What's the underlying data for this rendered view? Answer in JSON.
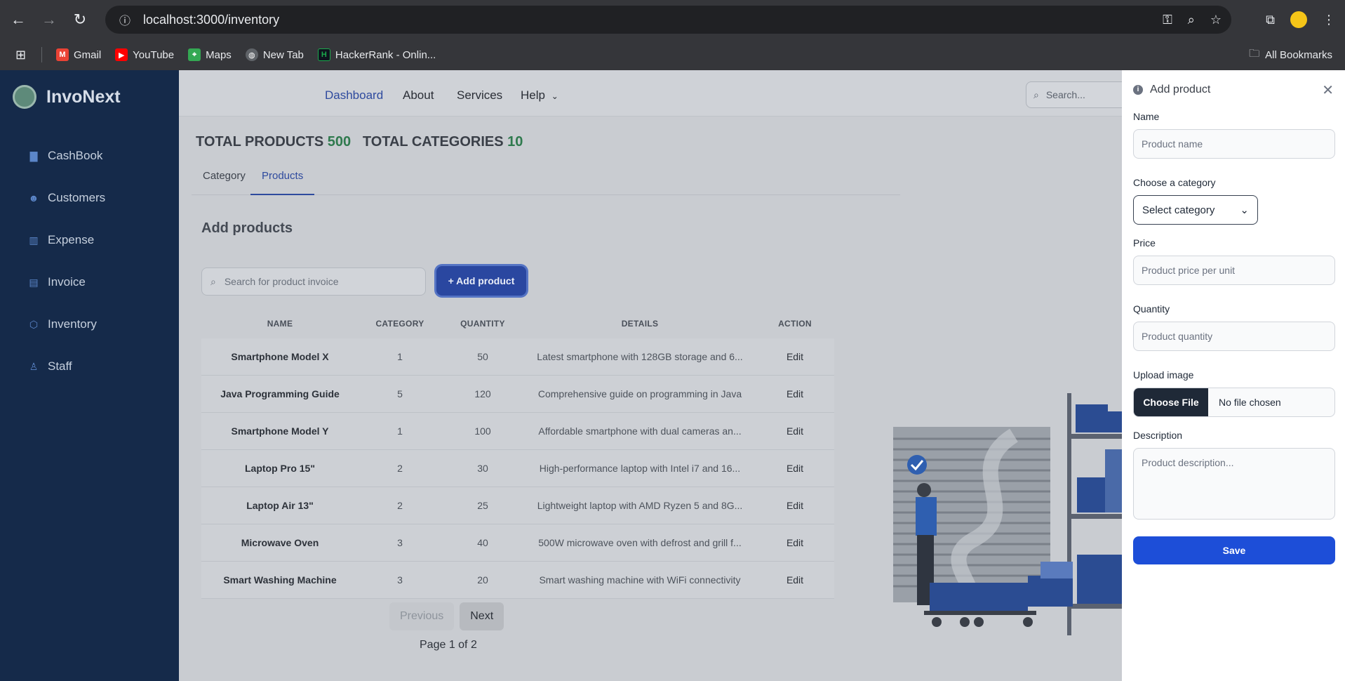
{
  "browser": {
    "url": "localhost:3000/inventory",
    "bookmarks": [
      {
        "label": "Gmail",
        "icon": "gmail-icon",
        "color": "#ea4335"
      },
      {
        "label": "YouTube",
        "icon": "youtube-icon",
        "color": "#ff0000"
      },
      {
        "label": "Maps",
        "icon": "maps-icon",
        "color": "#34a853"
      },
      {
        "label": "New Tab",
        "icon": "globe-icon",
        "color": "#9aa0a6"
      },
      {
        "label": "HackerRank - Onlin...",
        "icon": "hackerrank-icon",
        "color": "#1ba94c"
      }
    ],
    "all_bookmarks": "All Bookmarks"
  },
  "sidebar": {
    "brand": "InvoNext",
    "items": [
      {
        "label": "CashBook",
        "icon": "book-icon"
      },
      {
        "label": "Customers",
        "icon": "users-icon"
      },
      {
        "label": "Expense",
        "icon": "chart-icon"
      },
      {
        "label": "Invoice",
        "icon": "file-icon"
      },
      {
        "label": "Inventory",
        "icon": "box-icon"
      },
      {
        "label": "Staff",
        "icon": "staff-icon"
      }
    ]
  },
  "topnav": {
    "links": [
      "Dashboard",
      "About",
      "Services",
      "Help"
    ],
    "search_placeholder": "Search..."
  },
  "totals": {
    "products_label": "TOTAL PRODUCTS",
    "products_value": "500",
    "categories_label": "TOTAL CATEGORIES",
    "categories_value": "10"
  },
  "tabs": [
    "Category",
    "Products"
  ],
  "section_title": "Add products",
  "product_search_placeholder": "Search for product invoice",
  "add_product_label": "+ Add product",
  "table": {
    "headers": [
      "NAME",
      "CATEGORY",
      "QUANTITY",
      "DETAILS",
      "ACTION"
    ],
    "rows": [
      {
        "name": "Smartphone Model X",
        "category": "1",
        "quantity": "50",
        "details": "Latest smartphone with 128GB storage and 6...",
        "action": "Edit"
      },
      {
        "name": "Java Programming Guide",
        "category": "5",
        "quantity": "120",
        "details": "Comprehensive guide on programming in Java",
        "action": "Edit"
      },
      {
        "name": "Smartphone Model Y",
        "category": "1",
        "quantity": "100",
        "details": "Affordable smartphone with dual cameras an...",
        "action": "Edit"
      },
      {
        "name": "Laptop Pro 15\"",
        "category": "2",
        "quantity": "30",
        "details": "High-performance laptop with Intel i7 and 16...",
        "action": "Edit"
      },
      {
        "name": "Laptop Air 13\"",
        "category": "2",
        "quantity": "25",
        "details": "Lightweight laptop with AMD Ryzen 5 and 8G...",
        "action": "Edit"
      },
      {
        "name": "Microwave Oven",
        "category": "3",
        "quantity": "40",
        "details": "500W microwave oven with defrost and grill f...",
        "action": "Edit"
      },
      {
        "name": "Smart Washing Machine",
        "category": "3",
        "quantity": "20",
        "details": "Smart washing machine with WiFi connectivity",
        "action": "Edit"
      }
    ]
  },
  "pagination": {
    "previous": "Previous",
    "next": "Next",
    "info": "Page 1 of 2"
  },
  "drawer": {
    "title": "Add product",
    "name_label": "Name",
    "name_placeholder": "Product name",
    "category_label": "Choose a category",
    "category_value": "Select category",
    "price_label": "Price",
    "price_placeholder": "Product price per unit",
    "quantity_label": "Quantity",
    "quantity_placeholder": "Product quantity",
    "image_label": "Upload image",
    "choose_file": "Choose File",
    "file_status": "No file chosen",
    "description_label": "Description",
    "description_placeholder": "Product description...",
    "save": "Save"
  },
  "colors": {
    "sidebar_bg": "#152a4a",
    "accent": "#1d4ed8",
    "totals_number": "#2f7a4e"
  }
}
